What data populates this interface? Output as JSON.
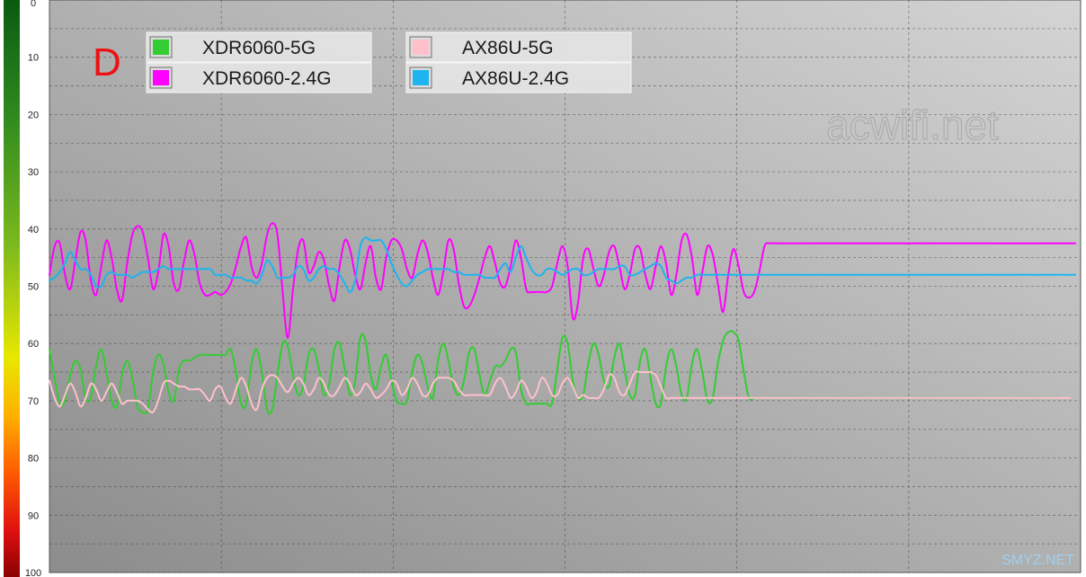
{
  "chart_data": {
    "type": "line",
    "title": "",
    "corner_label": "D",
    "watermarks": [
      "acwifi.net",
      "SMYZ.NET"
    ],
    "ylim": [
      0,
      100
    ],
    "y_inverted": true,
    "y_ticks": [
      0,
      10,
      20,
      30,
      40,
      50,
      60,
      70,
      80,
      90,
      100
    ],
    "grid": true,
    "legend_position": "top-left",
    "x": [
      0,
      1,
      2,
      3,
      4,
      5,
      6,
      7,
      8,
      9,
      10,
      11,
      12,
      13,
      14,
      15,
      16,
      17,
      18,
      19,
      20,
      21,
      22,
      23,
      24,
      25,
      26,
      27,
      28,
      29,
      30,
      31,
      32,
      33,
      34,
      35,
      36,
      37,
      38,
      39,
      40,
      41,
      42,
      43,
      44,
      45,
      46,
      47,
      48,
      49,
      50,
      51,
      52,
      53,
      54,
      55,
      56,
      57,
      58,
      59,
      60,
      61,
      62,
      63,
      64,
      65,
      66,
      67,
      68,
      69,
      70,
      71,
      72,
      73,
      74,
      75,
      76,
      77,
      78,
      79,
      80,
      81,
      82,
      83,
      84,
      85,
      86,
      87,
      88,
      89,
      90,
      91,
      92,
      93,
      94,
      95,
      96,
      97,
      98,
      99,
      100,
      101,
      102,
      103,
      104,
      105,
      106,
      107,
      108,
      109,
      110,
      111,
      112,
      113,
      114,
      115,
      116,
      117,
      118,
      119,
      120,
      121,
      122,
      123,
      124,
      125,
      126,
      127,
      128,
      129,
      130,
      131,
      132,
      133,
      134,
      135,
      136,
      137,
      138,
      139,
      140,
      141,
      142,
      143,
      144,
      145,
      146,
      147,
      148,
      149,
      150,
      151,
      152,
      153,
      154,
      155,
      156,
      157,
      158,
      159,
      160,
      161,
      162,
      163,
      164,
      165,
      166,
      167,
      168,
      169,
      170,
      171,
      172,
      173,
      174,
      175,
      176,
      177,
      178,
      179,
      180,
      181,
      182,
      183,
      184,
      185,
      186,
      187,
      188,
      189,
      190,
      191,
      192,
      193,
      194,
      195,
      196,
      197,
      198,
      199
    ],
    "series": [
      {
        "name": "XDR6060-5G",
        "color": "#33CC33",
        "values": [
          61,
          66,
          70.5,
          70,
          65.5,
          63,
          64.5,
          69.5,
          69.5,
          64,
          61,
          65,
          70,
          71,
          65.5,
          63,
          66,
          71,
          72,
          71.5,
          65,
          62,
          63.5,
          68.5,
          70,
          64.5,
          63,
          63,
          62.5,
          62,
          62,
          62,
          62,
          62,
          62,
          61,
          65,
          70.5,
          70.5,
          63.5,
          61,
          65,
          71.5,
          71.5,
          65.5,
          60,
          60.5,
          65.5,
          69,
          67.5,
          62,
          61,
          64.5,
          69,
          67,
          61,
          60,
          64.5,
          69,
          66.5,
          59,
          59.5,
          65.5,
          68,
          64,
          62,
          66.5,
          70,
          70.5,
          70,
          65,
          62,
          63.5,
          67.5,
          69.5,
          63,
          60,
          63,
          67.5,
          69,
          66.5,
          61.5,
          61,
          65.5,
          69,
          66.5,
          64,
          64,
          63,
          61,
          61.5,
          68,
          70.5,
          70.5,
          70.5,
          70.5,
          70.5,
          70.5,
          64.5,
          59,
          60,
          66.5,
          69.5,
          69,
          63.5,
          60,
          62,
          66.5,
          67.5,
          62.5,
          60,
          64.5,
          69,
          69,
          63,
          61,
          66,
          70.5,
          70.5,
          64,
          61,
          64,
          69,
          69.5,
          63.5,
          61,
          65,
          70,
          69.5,
          63.5,
          59.5,
          58,
          58,
          59.5,
          65,
          69.5,
          69.5,
          69.5,
          69.5,
          69.5,
          69.5,
          69.5,
          69.5,
          69.5,
          69.5,
          69.5,
          69.5,
          69.5,
          69.5,
          69.5,
          69.5,
          69.5,
          69.5,
          69.5,
          69.5,
          69.5,
          69.5,
          69.5,
          69.5,
          69.5,
          69.5,
          69.5,
          69.5,
          69.5,
          69.5,
          69.5,
          69.5,
          69.5,
          69.5,
          69.5,
          69.5,
          69.5,
          69.5,
          69.5,
          69.5,
          69.5,
          69.5,
          69.5,
          69.5,
          69.5,
          69.5,
          69.5,
          69.5,
          69.5,
          69.5,
          69.5,
          69.5,
          69.5,
          69.5,
          69.5,
          69.5,
          69.5,
          69.5,
          69.5,
          69.5,
          69.5
        ]
      },
      {
        "name": "XDR6060-2.4G",
        "color": "#FF00FF",
        "values": [
          48,
          43,
          42.5,
          48,
          50.5,
          45.5,
          40.5,
          42,
          49,
          51.5,
          46.5,
          42,
          45,
          50.5,
          52.5,
          46,
          41,
          39.5,
          40.5,
          45,
          50.5,
          47.5,
          41,
          43,
          49.5,
          50.5,
          45.5,
          42,
          44.5,
          49.5,
          51.5,
          51.5,
          51,
          51.5,
          51,
          49.5,
          46.5,
          43,
          41.5,
          46.5,
          48.5,
          46,
          41,
          39,
          41,
          51,
          59,
          50.5,
          43.5,
          42,
          47.5,
          46.5,
          44,
          45.5,
          50,
          52.5,
          46.5,
          42,
          43.5,
          48,
          50.5,
          46,
          43,
          48.5,
          50.5,
          45,
          42,
          42,
          43.5,
          47,
          48.5,
          44.5,
          42,
          44,
          48.5,
          51.5,
          47.5,
          42,
          43.5,
          49.5,
          53.5,
          53.5,
          51.5,
          48.5,
          45,
          43,
          46,
          49.5,
          50,
          46.5,
          42,
          45,
          50.5,
          51,
          51,
          51,
          51,
          50,
          46,
          43,
          46.5,
          55.5,
          53,
          45,
          43.5,
          47,
          50,
          48,
          44,
          43,
          46.5,
          50.5,
          48,
          43.5,
          43.5,
          48,
          50.5,
          46.5,
          43,
          46,
          51.5,
          48,
          42,
          41,
          45,
          51.5,
          47.5,
          43,
          44.5,
          49.5,
          54.5,
          48,
          43.5,
          46.5,
          51,
          52,
          51,
          47.5,
          43,
          42.5,
          42.5,
          42.5,
          42.5,
          42.5,
          42.5,
          42.5,
          42.5,
          42.5,
          42.5,
          42.5,
          42.5,
          42.5,
          42.5,
          42.5,
          42.5,
          42.5,
          42.5,
          42.5,
          42.5,
          42.5,
          42.5,
          42.5,
          42.5,
          42.5,
          42.5,
          42.5,
          42.5,
          42.5,
          42.5,
          42.5,
          42.5,
          42.5,
          42.5,
          42.5,
          42.5,
          42.5,
          42.5,
          42.5,
          42.5,
          42.5,
          42.5,
          42.5,
          42.5,
          42.5,
          42.5,
          42.5,
          42.5,
          42.5,
          42.5,
          42.5,
          42.5,
          42.5,
          42.5,
          42.5,
          42.5,
          42.5,
          42.5,
          42.5,
          42.5,
          42.5,
          42.5,
          42.5
        ]
      },
      {
        "name": "AX86U-5G",
        "color": "#FFC0CB",
        "values": [
          66.5,
          69.5,
          71,
          69,
          67,
          68.5,
          71,
          69.5,
          67,
          68,
          70,
          68.5,
          67,
          68.5,
          70.5,
          70,
          70,
          70,
          70.5,
          71.5,
          72,
          70,
          67,
          66.5,
          67,
          67.5,
          67.5,
          68,
          68,
          68,
          69,
          70,
          68,
          67.5,
          69.5,
          70.5,
          68,
          66,
          67.5,
          70.5,
          71.5,
          68,
          66,
          65.5,
          66,
          67.5,
          68.5,
          67,
          66,
          67,
          69,
          68,
          66,
          67,
          69,
          69,
          67.5,
          66,
          67,
          69,
          68.5,
          67,
          68,
          69.5,
          69,
          68,
          66.5,
          67,
          69,
          68,
          66,
          67,
          69,
          69,
          67,
          66,
          66,
          66,
          66.5,
          68,
          69,
          69,
          69,
          69,
          69,
          69,
          67,
          66,
          67.5,
          69.5,
          68.5,
          66.5,
          67.5,
          69.5,
          68.5,
          66,
          67,
          69,
          69,
          67,
          66,
          67.5,
          69.5,
          69,
          69.5,
          69.5,
          69.5,
          68,
          65.5,
          66,
          68.5,
          69,
          67,
          65,
          65,
          65,
          65,
          65.5,
          67.5,
          69.5,
          69.5,
          69.5,
          69.5,
          69.5,
          69.5,
          69.5,
          69.5,
          69.5,
          69.5,
          69.5,
          69.5,
          69.5,
          69.5,
          69.5,
          69.5,
          69.5,
          69.5,
          69.5,
          69.5,
          69.5,
          69.5,
          69.5,
          69.5,
          69.5,
          69.5,
          69.5,
          69.5,
          69.5,
          69.5,
          69.5,
          69.5,
          69.5,
          69.5,
          69.5,
          69.5,
          69.5,
          69.5,
          69.5,
          69.5,
          69.5,
          69.5,
          69.5,
          69.5,
          69.5,
          69.5,
          69.5,
          69.5,
          69.5,
          69.5,
          69.5,
          69.5,
          69.5,
          69.5,
          69.5,
          69.5,
          69.5,
          69.5,
          69.5,
          69.5,
          69.5,
          69.5,
          69.5,
          69.5,
          69.5,
          69.5,
          69.5,
          69.5,
          69.5,
          69.5,
          69.5,
          69.5,
          69.5,
          69.5,
          69.5,
          69.5,
          69.5,
          69.5,
          69.5
        ]
      },
      {
        "name": "AX86U-2.4G",
        "color": "#1EB4F0",
        "values": [
          49,
          48.5,
          47.5,
          46,
          44,
          45.5,
          47,
          47,
          48,
          50,
          50,
          48,
          47.5,
          48,
          48,
          48,
          48.5,
          48,
          47.5,
          47.5,
          47.5,
          47,
          46.5,
          47,
          47,
          47,
          47,
          47,
          47,
          47,
          47,
          47,
          48,
          48,
          48,
          48.5,
          48.5,
          48.5,
          49,
          49,
          49.5,
          48,
          45.5,
          46.5,
          48.5,
          48.5,
          48.5,
          48,
          46.5,
          47,
          49,
          48.5,
          47,
          46.5,
          47,
          47,
          48,
          49.5,
          51,
          49,
          43,
          41.5,
          42,
          42,
          42,
          43.5,
          46,
          48,
          49.5,
          50,
          49,
          48,
          47.5,
          47,
          47,
          47,
          47,
          47,
          47.5,
          47.5,
          48,
          48,
          48,
          48,
          48.5,
          48.5,
          48.5,
          47,
          46,
          47.5,
          45,
          43,
          45,
          47,
          48,
          48,
          47,
          47,
          47.5,
          48,
          47.5,
          47,
          47,
          48,
          48,
          47.5,
          47,
          47,
          47,
          47,
          46.5,
          46.5,
          48,
          48,
          47.5,
          47,
          46.5,
          46,
          46.5,
          48.5,
          49,
          49.5,
          49,
          48.5,
          48.5,
          48,
          48,
          48,
          48,
          48,
          48,
          48,
          48,
          48,
          48,
          48,
          48,
          48,
          48,
          48,
          48,
          48,
          48,
          48,
          48,
          48,
          48,
          48,
          48,
          48,
          48,
          48,
          48,
          48,
          48,
          48,
          48,
          48,
          48,
          48,
          48,
          48,
          48,
          48,
          48,
          48,
          48,
          48,
          48,
          48,
          48,
          48,
          48,
          48,
          48,
          48,
          48,
          48,
          48,
          48,
          48,
          48,
          48,
          48,
          48,
          48,
          48,
          48,
          48,
          48,
          48,
          48,
          48,
          48,
          48,
          48,
          48,
          48,
          48,
          48,
          48,
          48,
          48,
          48,
          48,
          48
        ]
      }
    ]
  }
}
